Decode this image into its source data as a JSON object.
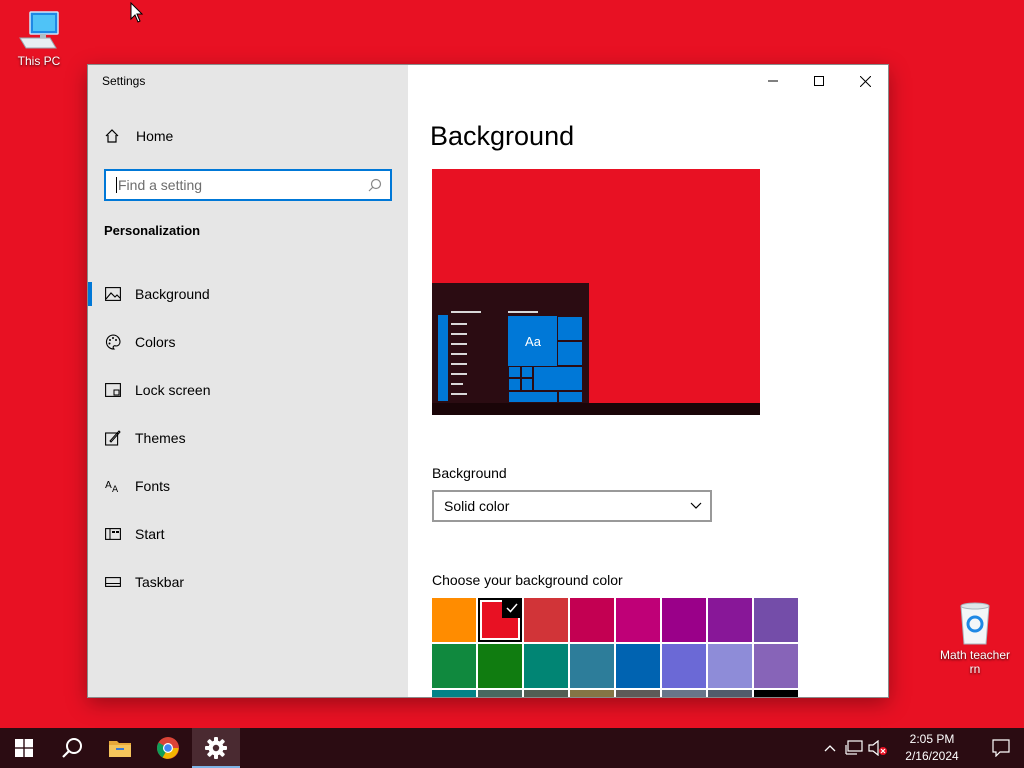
{
  "desktop": {
    "icons": [
      {
        "label": "This PC",
        "icon": "computer-icon"
      },
      {
        "label": "Math teacher rn",
        "icon": "recycle-bin-icon"
      }
    ],
    "background_color": "#e81123"
  },
  "window": {
    "title": "Settings",
    "controls": [
      "minimize-icon",
      "maximize-icon",
      "close-icon"
    ]
  },
  "sidebar": {
    "home_label": "Home",
    "search_placeholder": "Find a setting",
    "section_title": "Personalization",
    "items": [
      {
        "label": "Background",
        "icon": "picture-icon",
        "active": true
      },
      {
        "label": "Colors",
        "icon": "palette-icon",
        "active": false
      },
      {
        "label": "Lock screen",
        "icon": "lock-screen-icon",
        "active": false
      },
      {
        "label": "Themes",
        "icon": "themes-icon",
        "active": false
      },
      {
        "label": "Fonts",
        "icon": "fonts-icon",
        "active": false
      },
      {
        "label": "Start",
        "icon": "start-icon",
        "active": false
      },
      {
        "label": "Taskbar",
        "icon": "taskbar-icon",
        "active": false
      }
    ]
  },
  "main": {
    "title": "Background",
    "preview": {
      "tile_text": "Aa",
      "accent": "#0078d7",
      "background": "#e81123"
    },
    "background_label": "Background",
    "background_value": "Solid color",
    "color_label": "Choose your background color",
    "colors": [
      "#ff8c00",
      "#e81123",
      "#d13438",
      "#c30052",
      "#bf0077",
      "#9a0089",
      "#881798",
      "#744da9",
      "#10893e",
      "#107c10",
      "#018574",
      "#2d7d9a",
      "#0063b1",
      "#6b69d6",
      "#8e8cd8",
      "#8764b8",
      "#038387",
      "#486860",
      "#525e54",
      "#847545",
      "#5d5a58",
      "#68768a",
      "#515c6b",
      "#000000"
    ],
    "selected_color_index": 1
  },
  "taskbar": {
    "apps": [
      "windows-start-icon",
      "search-icon",
      "file-explorer-icon",
      "chrome-icon",
      "settings-gear-icon"
    ],
    "time": "2:05 PM",
    "date": "2/16/2024"
  }
}
